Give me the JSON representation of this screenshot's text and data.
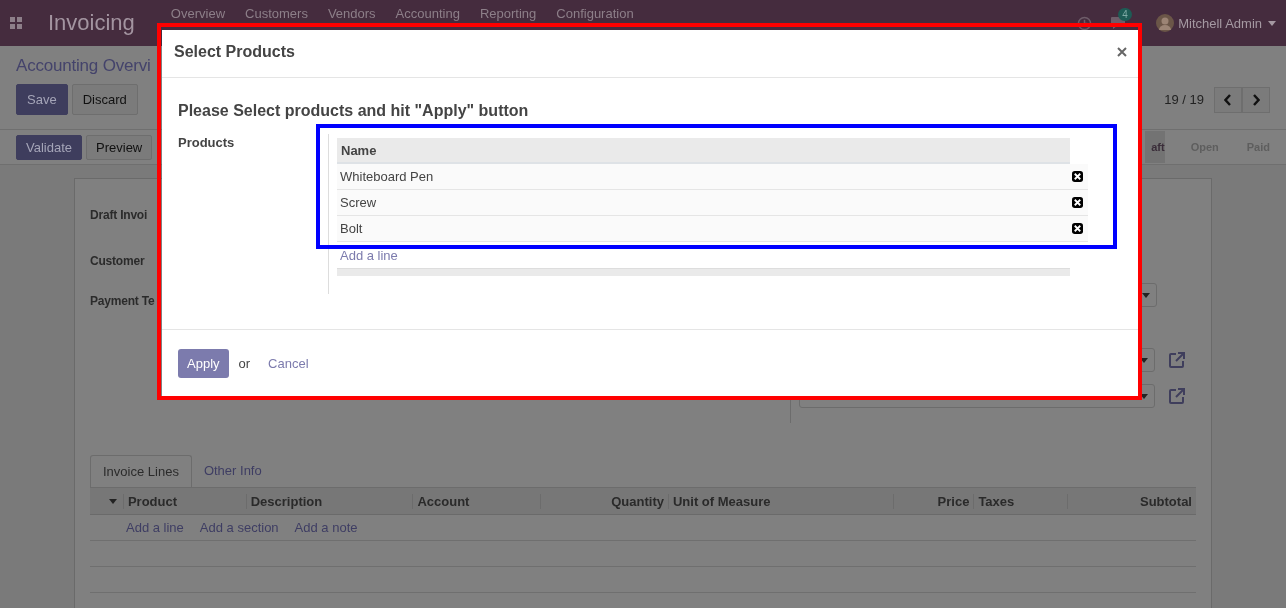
{
  "navbar": {
    "app_title": "Invoicing",
    "menu": [
      "Overview",
      "Customers",
      "Vendors",
      "Accounting",
      "Reporting",
      "Configuration"
    ],
    "chat_count": "4",
    "user": "Mitchell Admin"
  },
  "breadcrumb": "Accounting Overvi",
  "form_buttons": [
    "Save",
    "Discard"
  ],
  "pager": "19 / 19",
  "status_buttons": [
    "Validate",
    "Preview"
  ],
  "status_steps": [
    {
      "label": "aft",
      "selected": true
    },
    {
      "label": "Open",
      "selected": false
    },
    {
      "label": "Paid",
      "selected": false
    }
  ],
  "fields": [
    "Draft Invoi",
    "Customer",
    "Payment Te"
  ],
  "tabs": [
    {
      "label": "Invoice Lines",
      "selected": true
    },
    {
      "label": "Other Info",
      "selected": false
    }
  ],
  "lines_table": {
    "columns": [
      {
        "label": "Product",
        "numeric": false
      },
      {
        "label": "Description",
        "numeric": false
      },
      {
        "label": "Account",
        "numeric": false
      },
      {
        "label": "Quantity",
        "numeric": true
      },
      {
        "label": "Unit of Measure",
        "numeric": false
      },
      {
        "label": "Price",
        "numeric": true
      },
      {
        "label": "Taxes",
        "numeric": false
      },
      {
        "label": "Subtotal",
        "numeric": true
      }
    ],
    "actions": [
      "Add a line",
      "Add a section",
      "Add a note"
    ]
  },
  "dialog": {
    "title": "Select Products",
    "heading": "Please Select products and hit \"Apply\" button",
    "field_label": "Products",
    "column": "Name",
    "rows": [
      "Whiteboard Pen",
      "Screw",
      "Bolt"
    ],
    "add_line": "Add a line",
    "apply": "Apply",
    "or": "or",
    "cancel": "Cancel"
  },
  "annotations": [
    {
      "color": "#ff0000"
    },
    {
      "color": "#0000ff"
    }
  ]
}
